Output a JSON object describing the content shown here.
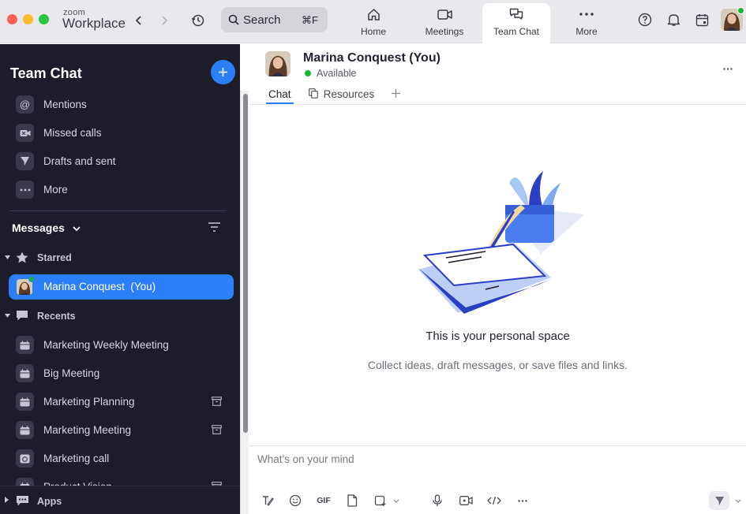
{
  "app": {
    "logo_small": "zoom",
    "logo_big": "Workplace"
  },
  "search": {
    "label": "Search",
    "shortcut": "⌘F"
  },
  "top_tabs": [
    {
      "label": "Home",
      "icon": "home-icon"
    },
    {
      "label": "Meetings",
      "icon": "video-icon"
    },
    {
      "label": "Team Chat",
      "icon": "chat-icon",
      "active": true
    },
    {
      "label": "More",
      "icon": "more-dots-icon"
    }
  ],
  "sidebar": {
    "title": "Team Chat",
    "quick_items": [
      {
        "label": "Mentions",
        "icon": "at-icon"
      },
      {
        "label": "Missed calls",
        "icon": "missed-call-icon"
      },
      {
        "label": "Drafts and sent",
        "icon": "send-icon"
      },
      {
        "label": "More",
        "icon": "more-dots-icon"
      }
    ],
    "messages_title": "Messages",
    "starred_label": "Starred",
    "starred_items": [
      {
        "name": "Marina Conquest",
        "suffix": "(You)"
      }
    ],
    "recents_label": "Recents",
    "recent_items": [
      {
        "label": "Marketing Weekly Meeting",
        "archived": false
      },
      {
        "label": "Big Meeting",
        "archived": false
      },
      {
        "label": "Marketing Planning",
        "archived": true
      },
      {
        "label": "Marketing Meeting",
        "archived": true
      },
      {
        "label": "Marketing call",
        "archived": false
      },
      {
        "label": "Product Vision",
        "archived": true
      }
    ],
    "apps_label": "Apps"
  },
  "conversation": {
    "name": "Marina Conquest (You)",
    "status": "Available",
    "tabs": [
      "Chat",
      "Resources"
    ],
    "empty_title": "This is your personal space",
    "empty_subtitle": "Collect ideas, draft messages, or save files and links.",
    "composer_placeholder": "What's on your mind",
    "toolbar": {
      "gif_label": "GIF"
    }
  },
  "colors": {
    "accent": "#2d7ff9",
    "sidebar_bg": "#1c1c2b",
    "status_green": "#19b52f"
  }
}
